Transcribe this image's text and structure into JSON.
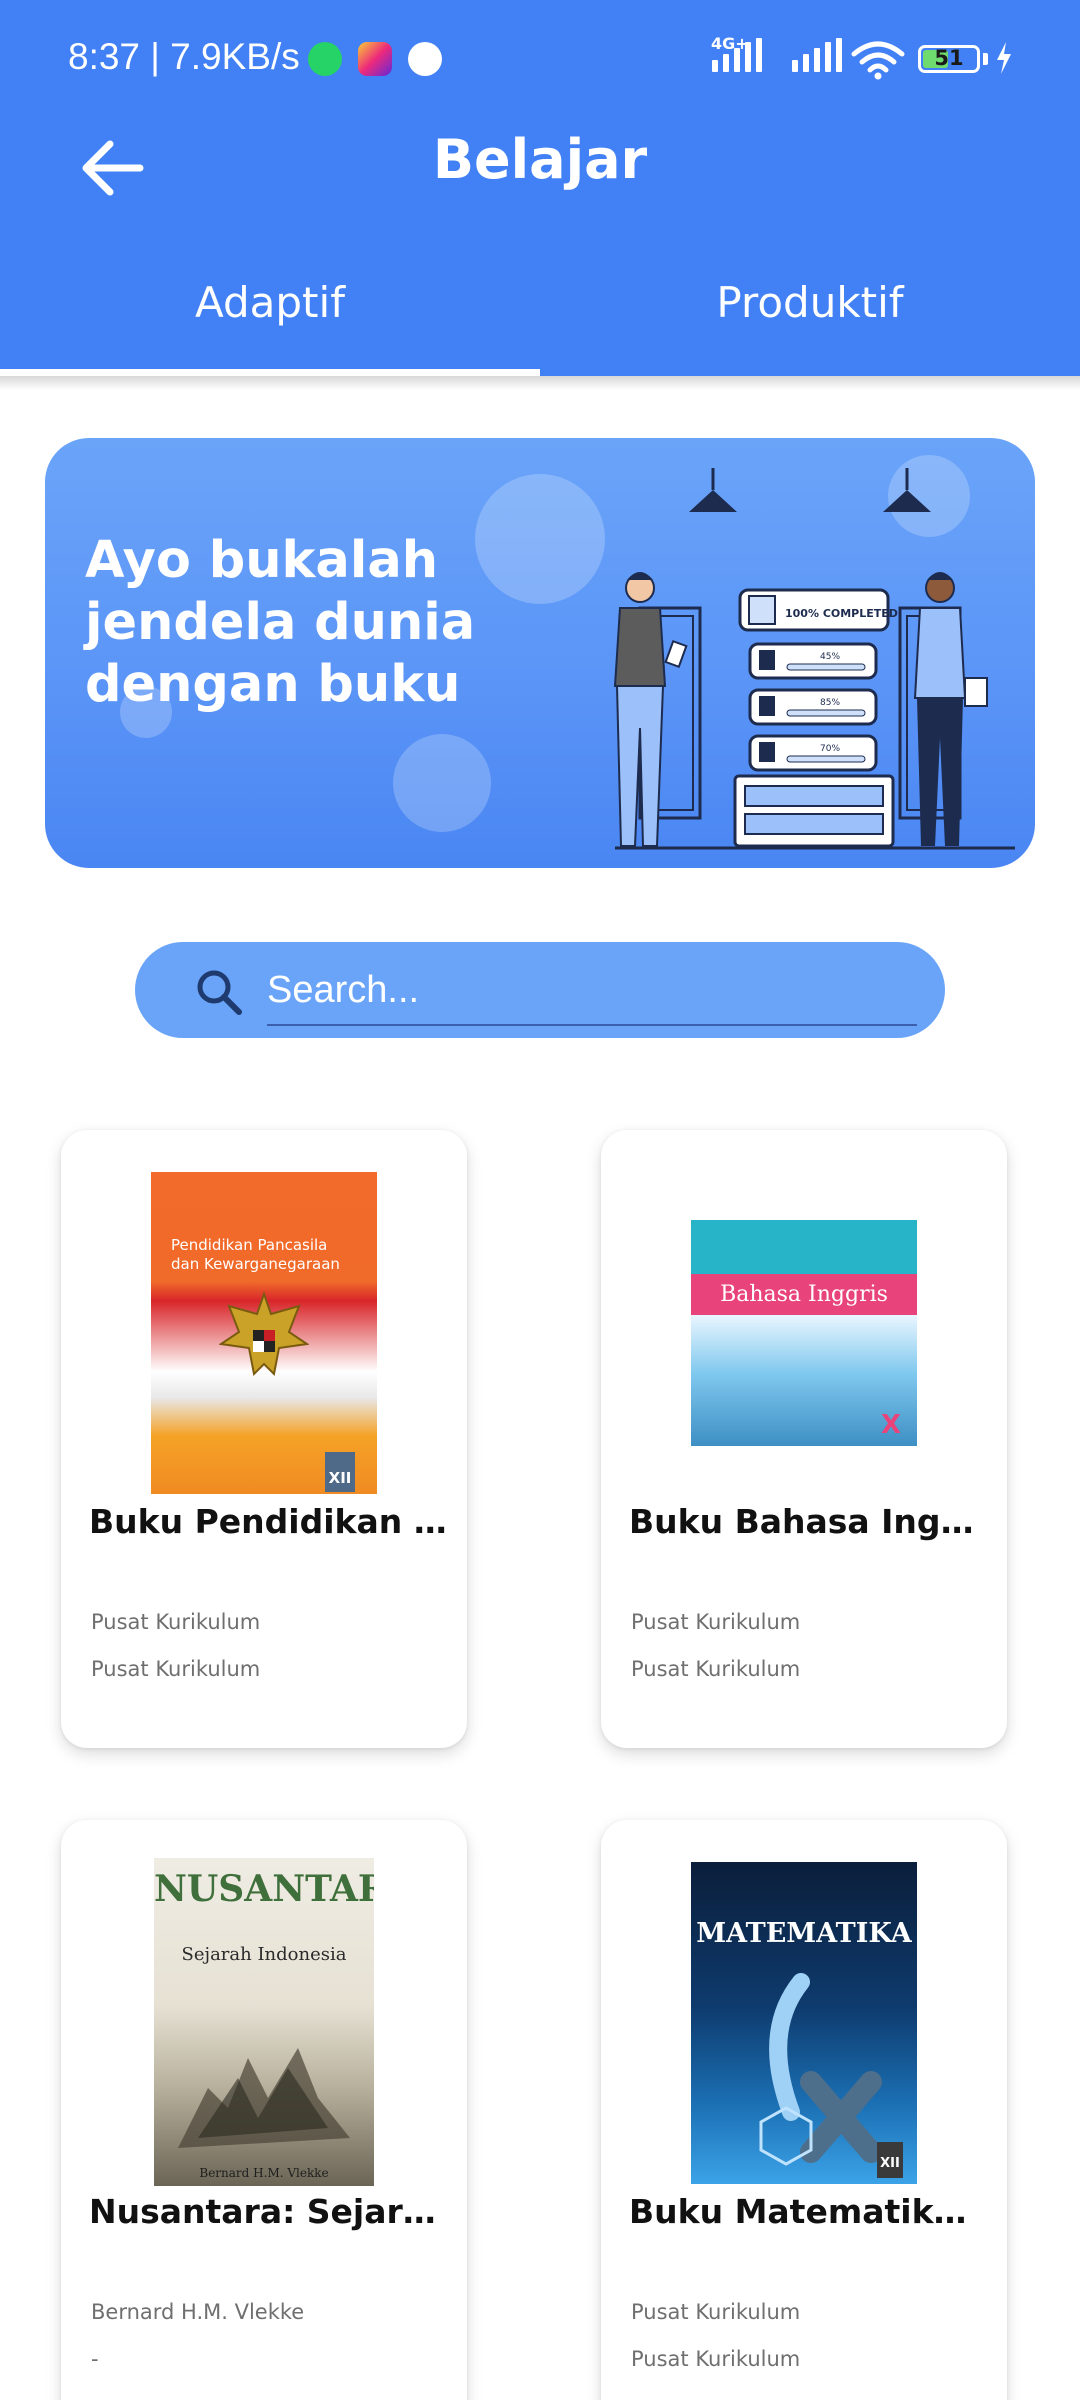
{
  "status_bar": {
    "time": "8:37 | 7.9KB/s",
    "network": "4G+",
    "battery": "51",
    "battery_level": 0.51
  },
  "header": {
    "title": "Belajar"
  },
  "tabs": [
    {
      "label": "Adaptif",
      "active": true
    },
    {
      "label": "Produktif",
      "active": false
    }
  ],
  "banner": {
    "text": "Ayo bukalah jendela dunia dengan buku",
    "illustration_labels": [
      "100% COMPLETED",
      "45%",
      "85%",
      "70%"
    ]
  },
  "search": {
    "placeholder": "Search..."
  },
  "books": [
    {
      "title": "Buku Pendidikan P...",
      "author": "Pusat Kurikulum",
      "publisher": "Pusat Kurikulum",
      "cover_title": "Pendidikan Pancasila dan Kewarganegaraan",
      "cover_badge": "XII"
    },
    {
      "title": "Buku Bahasa Inggri...",
      "author": "Pusat Kurikulum",
      "publisher": "Pusat Kurikulum",
      "cover_title": "Bahasa Inggris",
      "cover_badge": "X"
    },
    {
      "title": "Nusantara: Sejarah...",
      "author": "Bernard H.M. Vlekke",
      "publisher": "-",
      "cover_title": "NUSANTARA",
      "cover_subtitle": "Sejarah Indonesia",
      "cover_author": "Bernard H.M. Vlekke"
    },
    {
      "title": "Buku Matematika K...",
      "author": "Pusat Kurikulum",
      "publisher": "Pusat Kurikulum",
      "cover_title": "MATEMATIKA",
      "cover_badge": "XII"
    }
  ],
  "colors": {
    "primary": "#4281f5",
    "banner": "#5b95f7",
    "search": "#6aa4f9"
  },
  "icons": [
    "back-arrow-icon",
    "search-icon",
    "whatsapp-icon",
    "instagram-icon",
    "settings-icon",
    "signal-icon",
    "wifi-icon",
    "battery-icon",
    "charging-icon"
  ]
}
